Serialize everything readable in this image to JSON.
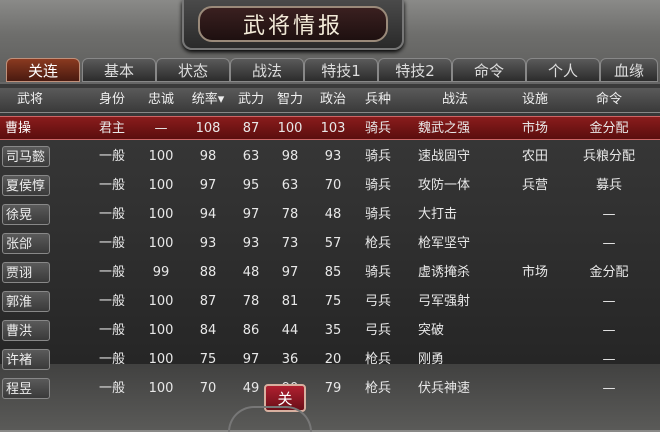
{
  "title": "武将情报",
  "tabs": [
    "关连",
    "基本",
    "状态",
    "战法",
    "特技1",
    "特技2",
    "命令",
    "个人",
    "血缘"
  ],
  "active_tab": 0,
  "columns": [
    "武将",
    "身份",
    "忠诚",
    "统率▾",
    "武力",
    "智力",
    "政治",
    "兵种",
    "战法",
    "设施",
    "命令"
  ],
  "rows": [
    {
      "name": "曹操",
      "status": "君主",
      "loyalty": "—",
      "lead": "108",
      "war": "87",
      "int": "100",
      "pol": "103",
      "unit": "骑兵",
      "tactic": "魏武之强",
      "facility": "市场",
      "order": "金分配"
    },
    {
      "name": "司马懿",
      "status": "一般",
      "loyalty": "100",
      "lead": "98",
      "war": "63",
      "int": "98",
      "pol": "93",
      "unit": "骑兵",
      "tactic": "速战固守",
      "facility": "农田",
      "order": "兵粮分配"
    },
    {
      "name": "夏侯惇",
      "status": "一般",
      "loyalty": "100",
      "lead": "97",
      "war": "95",
      "int": "63",
      "pol": "70",
      "unit": "骑兵",
      "tactic": "攻防一体",
      "facility": "兵营",
      "order": "募兵"
    },
    {
      "name": "徐晃",
      "status": "一般",
      "loyalty": "100",
      "lead": "94",
      "war": "97",
      "int": "78",
      "pol": "48",
      "unit": "骑兵",
      "tactic": "大打击",
      "facility": "",
      "order": "—"
    },
    {
      "name": "张郃",
      "status": "一般",
      "loyalty": "100",
      "lead": "93",
      "war": "93",
      "int": "73",
      "pol": "57",
      "unit": "枪兵",
      "tactic": "枪军坚守",
      "facility": "",
      "order": "—"
    },
    {
      "name": "贾诩",
      "status": "一般",
      "loyalty": "99",
      "lead": "88",
      "war": "48",
      "int": "97",
      "pol": "85",
      "unit": "骑兵",
      "tactic": "虚诱掩杀",
      "facility": "市场",
      "order": "金分配"
    },
    {
      "name": "郭淮",
      "status": "一般",
      "loyalty": "100",
      "lead": "87",
      "war": "78",
      "int": "81",
      "pol": "75",
      "unit": "弓兵",
      "tactic": "弓军强射",
      "facility": "",
      "order": "—"
    },
    {
      "name": "曹洪",
      "status": "一般",
      "loyalty": "100",
      "lead": "84",
      "war": "86",
      "int": "44",
      "pol": "35",
      "unit": "弓兵",
      "tactic": "突破",
      "facility": "",
      "order": "—"
    },
    {
      "name": "许褚",
      "status": "一般",
      "loyalty": "100",
      "lead": "75",
      "war": "97",
      "int": "36",
      "pol": "20",
      "unit": "枪兵",
      "tactic": "刚勇",
      "facility": "",
      "order": "—"
    },
    {
      "name": "程昱",
      "status": "一般",
      "loyalty": "100",
      "lead": "70",
      "war": "49",
      "int": "90",
      "pol": "79",
      "unit": "枪兵",
      "tactic": "伏兵神速",
      "facility": "",
      "order": "—"
    }
  ],
  "selected_row": 0,
  "close_label": "关"
}
